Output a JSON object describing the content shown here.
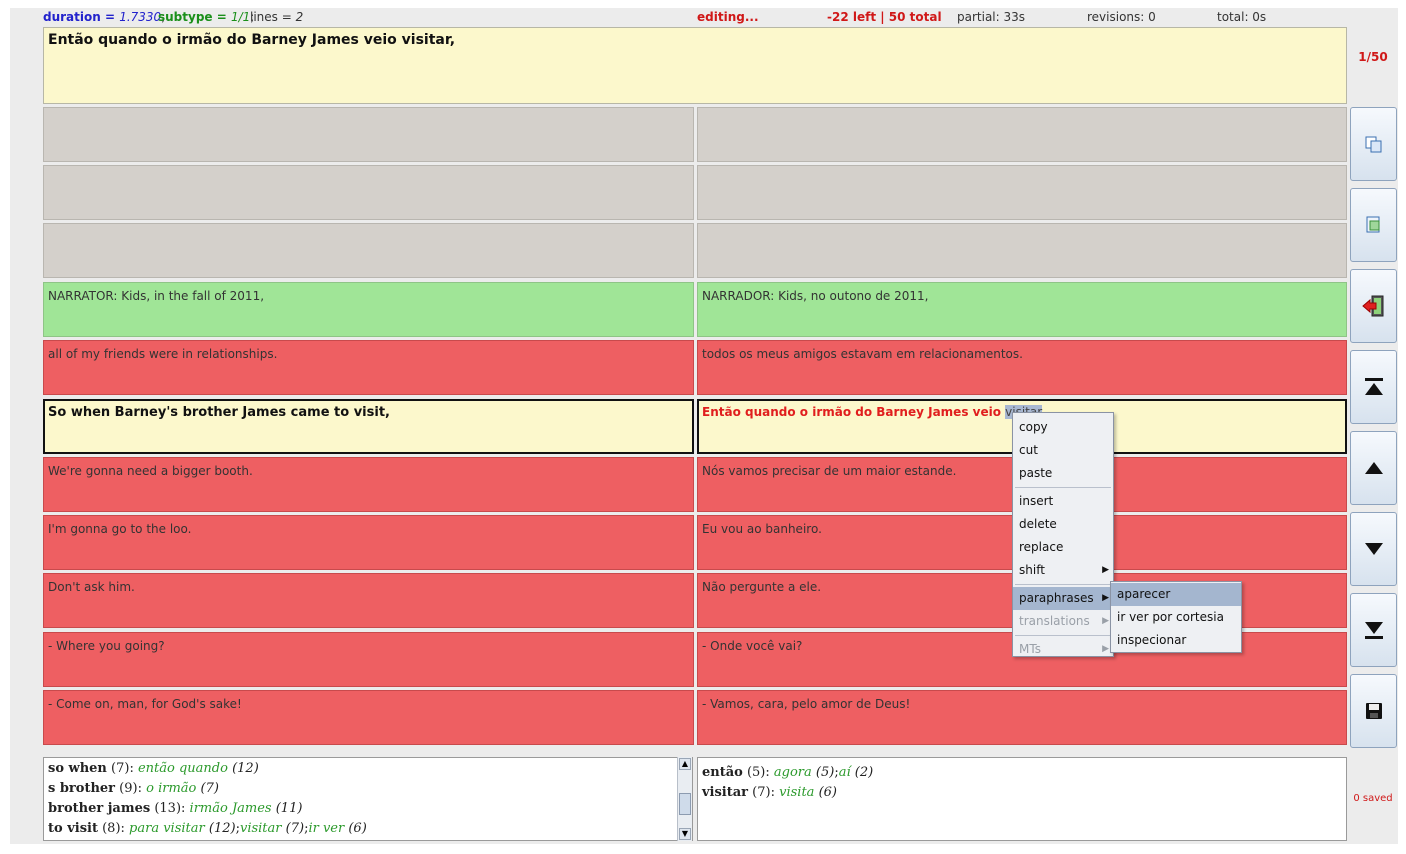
{
  "status": {
    "duration_label": "duration = ",
    "duration_value": "1.7330",
    "subtype_label": "subtype = ",
    "subtype_value": "1/1",
    "lines_label": "lines = ",
    "lines_value": "2",
    "editing": "editing...",
    "left_total": "-22 left | 50 total",
    "partial": "partial: 33s",
    "revisions": "revisions: 0",
    "total": "total: 0s"
  },
  "editor": {
    "text": "Então quando o irmão do Barney James veio visitar,"
  },
  "counter": "1/50",
  "rows": [
    {
      "source": "",
      "target": "",
      "state": "gray"
    },
    {
      "source": "",
      "target": "",
      "state": "gray"
    },
    {
      "source": "",
      "target": "",
      "state": "gray"
    },
    {
      "source": "NARRATOR: Kids, in the fall of 2011,",
      "target": "NARRADOR: Kids, no outono de 2011,",
      "state": "green"
    },
    {
      "source": "all of my friends were in relationships.",
      "target": "todos os meus amigos estavam em relacionamentos.",
      "state": "red"
    },
    {
      "source": "So when Barney's brother James came to visit,",
      "target_before": "Então quando o irmão do Barney James veio ",
      "target_selected": "visitar",
      "state": "current"
    },
    {
      "source": "We're gonna need a bigger booth.",
      "target": "Nós vamos precisar de um maior estande.",
      "state": "red"
    },
    {
      "source": "I'm gonna go to the loo.",
      "target": "Eu vou ao banheiro.",
      "state": "red"
    },
    {
      "source": "Don't ask him.",
      "target": "Não pergunte a ele.",
      "state": "red"
    },
    {
      "source": "- Where you going?",
      "target": "- Onde você vai?",
      "state": "red"
    },
    {
      "source": "- Come on, man, for God's sake!",
      "target": "- Vamos, cara, pelo amor de Deus!",
      "state": "red"
    }
  ],
  "context_menu": {
    "group1": [
      "copy",
      "cut",
      "paste"
    ],
    "group2": [
      "insert",
      "delete",
      "replace",
      "shift"
    ],
    "paraphrases": "paraphrases",
    "translations": "translations",
    "mts": "MTs"
  },
  "submenu": [
    "aparecer",
    "ir ver por cortesia",
    "inspecionar"
  ],
  "side_buttons": [
    "copy-source-icon",
    "copy-target-icon",
    "exit-icon",
    "first-icon",
    "up-icon",
    "down-icon",
    "last-icon",
    "save-icon"
  ],
  "left_phrases": [
    {
      "src": "so when",
      "cnt": "(7)",
      "tr": [
        {
          "t": "então quando",
          "n": "(12)"
        }
      ]
    },
    {
      "src": "s brother",
      "cnt": "(9)",
      "tr": [
        {
          "t": "o irmão",
          "n": "(7)"
        }
      ]
    },
    {
      "src": "brother james",
      "cnt": "(13)",
      "tr": [
        {
          "t": "irmão James",
          "n": "(11)"
        }
      ]
    },
    {
      "src": "to visit",
      "cnt": "(8)",
      "tr": [
        {
          "t": "para visitar",
          "n": "(12)"
        },
        {
          "t": "visitar",
          "n": "(7)"
        },
        {
          "t": "ir ver",
          "n": "(6)"
        }
      ]
    }
  ],
  "right_phrases": [
    {
      "src": "então",
      "cnt": "(5)",
      "tr": [
        {
          "t": "agora",
          "n": "(5)"
        },
        {
          "t": "aí",
          "n": "(2)"
        }
      ]
    },
    {
      "src": "visitar",
      "cnt": "(7)",
      "tr": [
        {
          "t": "visita",
          "n": "(6)"
        }
      ]
    }
  ],
  "saved": "0 saved",
  "colors": {
    "accent": "#d01818",
    "green_row": "#a0e597",
    "red_row": "#ee5f62",
    "gray_row": "#d4d0cb",
    "current_row": "#fcf8cc",
    "phrase_green": "#2c9a2c"
  }
}
